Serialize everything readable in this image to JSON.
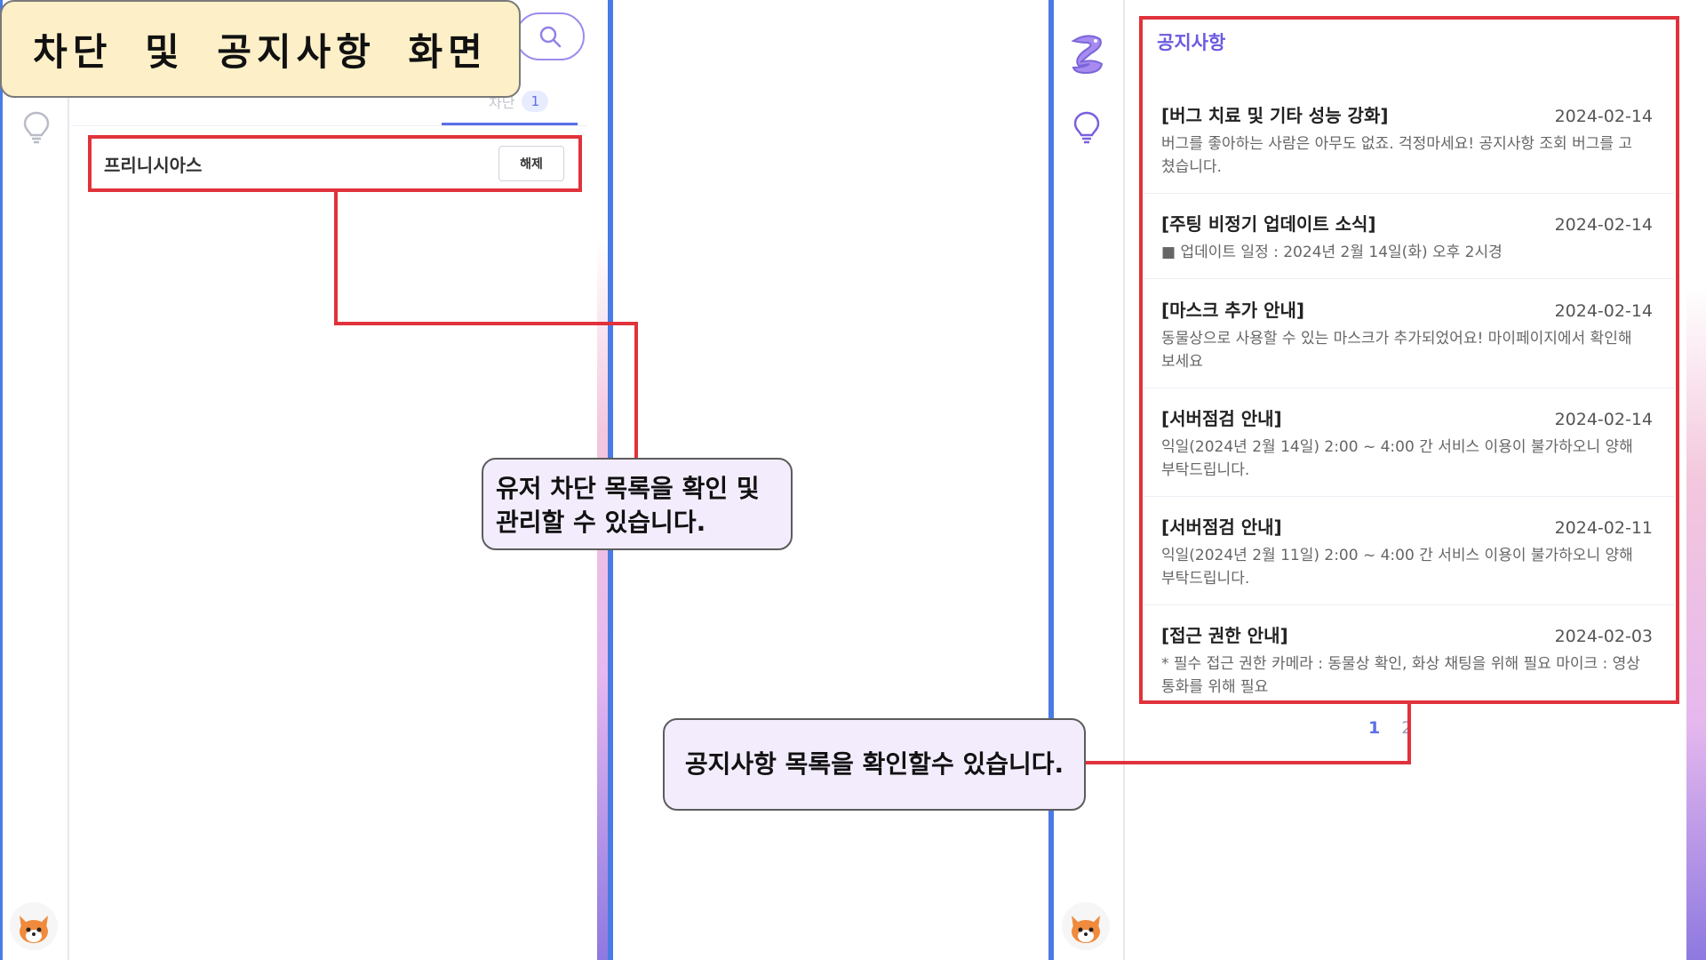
{
  "slide_title": "차단  및  공지사항  화면",
  "left": {
    "tabs": [
      {
        "label": "",
        "badge": ""
      },
      {
        "label": "",
        "badge": ""
      },
      {
        "label": "차단",
        "badge": "1"
      }
    ],
    "blocked_list": [
      {
        "name": "프리니시아스",
        "action_label": "해제"
      }
    ]
  },
  "right": {
    "heading": "공지사항",
    "notices": [
      {
        "title": "[버그 치료 및 기타 성능 강화]",
        "date": "2024-02-14",
        "desc": "버그를 좋아하는 사람은 아무도 없죠. 걱정마세요! 공지사항 조회 버그를 고쳤습니다."
      },
      {
        "title": "[주팅 비정기 업데이트 소식]",
        "date": "2024-02-14",
        "desc": "■ 업데이트 일정 : 2024년 2월 14일(화) 오후 2시경"
      },
      {
        "title": "[마스크 추가 안내]",
        "date": "2024-02-14",
        "desc": "동물상으로 사용할 수 있는 마스크가 추가되었어요! 마이페이지에서 확인해보세요"
      },
      {
        "title": "[서버점검 안내]",
        "date": "2024-02-14",
        "desc": "익일(2024년 2월 14일) 2:00 ~ 4:00 간 서비스 이용이 불가하오니 양해부탁드립니다."
      },
      {
        "title": "[서버점검 안내]",
        "date": "2024-02-11",
        "desc": "익일(2024년 2월 11일) 2:00 ~ 4:00 간 서비스 이용이 불가하오니 양해부탁드립니다."
      },
      {
        "title": "[접근 권한 안내]",
        "date": "2024-02-03",
        "desc": "* 필수 접근 권한 카메라 : 동물상 확인, 화상 채팅을 위해 필요 마이크 : 영상 통화를 위해 필요"
      }
    ],
    "pagination": {
      "current": "1",
      "next": "2"
    }
  },
  "callouts": {
    "block": "유저 차단 목록을 확인 및 관리할 수 있습니다.",
    "notice": "공지사항 목록을 확인할수 있습니다."
  },
  "colors": {
    "accent_red": "#e0323a",
    "brand_blue": "#4a7ae6",
    "brand_purple": "#6b5be0",
    "title_bg": "#fdf0c8",
    "callout_bg": "#f3ecfd"
  },
  "icons": [
    "search-icon",
    "lightbulb-icon",
    "app-logo-icon",
    "fox-avatar-icon"
  ]
}
